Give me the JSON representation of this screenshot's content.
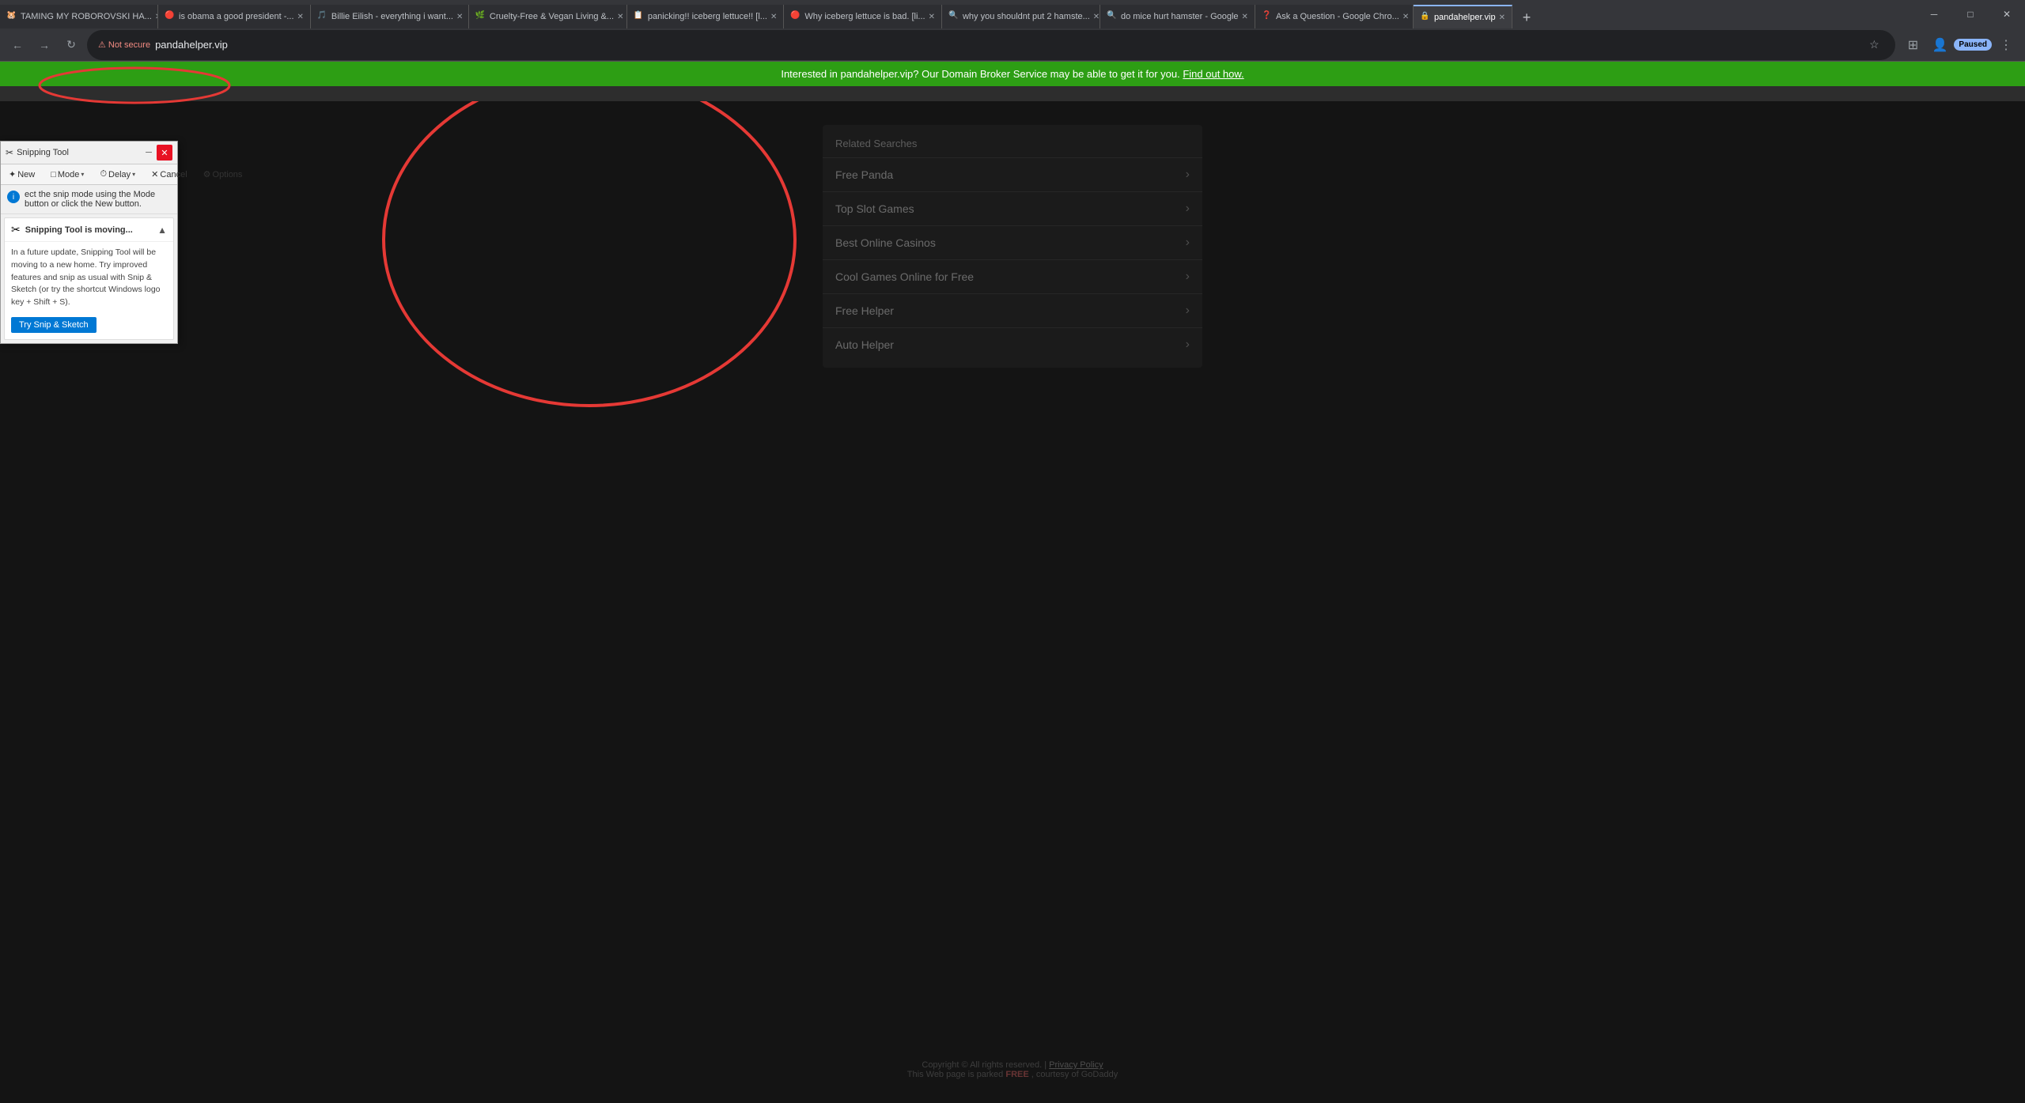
{
  "browser": {
    "tabs": [
      {
        "id": "tab1",
        "title": "TAMING MY ROBOROVSKI HA...",
        "active": false,
        "favicon": "🐹"
      },
      {
        "id": "tab2",
        "title": "is obama a good president -...",
        "active": false,
        "favicon": "🔴"
      },
      {
        "id": "tab3",
        "title": "Billie Eilish - everything i want...",
        "active": false,
        "favicon": "🎵"
      },
      {
        "id": "tab4",
        "title": "Cruelty-Free & Vegan Living &...",
        "active": false,
        "favicon": "🌿"
      },
      {
        "id": "tab5",
        "title": "panicking!! iceberg lettuce!! [l...",
        "active": false,
        "favicon": "📋"
      },
      {
        "id": "tab6",
        "title": "Why iceberg lettuce is bad. [li...",
        "active": false,
        "favicon": "🔴"
      },
      {
        "id": "tab7",
        "title": "why you shouldnt put 2 hamste...",
        "active": false,
        "favicon": "🔍"
      },
      {
        "id": "tab8",
        "title": "do mice hurt hamster - Google",
        "active": false,
        "favicon": "🔍"
      },
      {
        "id": "tab9",
        "title": "Ask a Question - Google Chro...",
        "active": false,
        "favicon": "❓"
      },
      {
        "id": "tab10",
        "title": "pandahelper.vip",
        "active": true,
        "favicon": "🔒"
      }
    ],
    "address": "pandahelper.vip",
    "not_secure_label": "Not secure",
    "paused_label": "Paused"
  },
  "notification_bar": {
    "text": "Interested in pandahelper.vip? Our Domain Broker Service may be able to get it for you.",
    "link_text": "Find out how."
  },
  "webpage": {
    "related_searches_heading": "Related Searches",
    "search_items": [
      {
        "label": "Free Panda"
      },
      {
        "label": "Top Slot Games"
      },
      {
        "label": "Best Online Casinos"
      },
      {
        "label": "Cool Games Online for Free"
      },
      {
        "label": "Free Helper"
      },
      {
        "label": "Auto Helper"
      }
    ],
    "footer": {
      "copyright": "Copyright ©  All rights reserved.",
      "separator": "|",
      "privacy": "Privacy Policy",
      "parked_text": "This Web page is parked",
      "free_label": "FREE",
      "parked_suffix": ", courtesy of GoDaddy"
    }
  },
  "snipping_tool": {
    "title": "Snipping Tool",
    "new_label": "New",
    "mode_label": "Mode",
    "delay_label": "Delay",
    "cancel_label": "Cancel",
    "options_label": "Options",
    "instruction": "ect the snip mode using the Mode button or click the New button.",
    "notification_title": "Snipping Tool is moving...",
    "notification_body": "In a future update, Snipping Tool will be moving to a new home. Try improved features and snip as usual with Snip & Sketch (or try the shortcut\nWindows logo key + Shift + S).",
    "try_btn_label": "Try Snip & Sketch"
  }
}
